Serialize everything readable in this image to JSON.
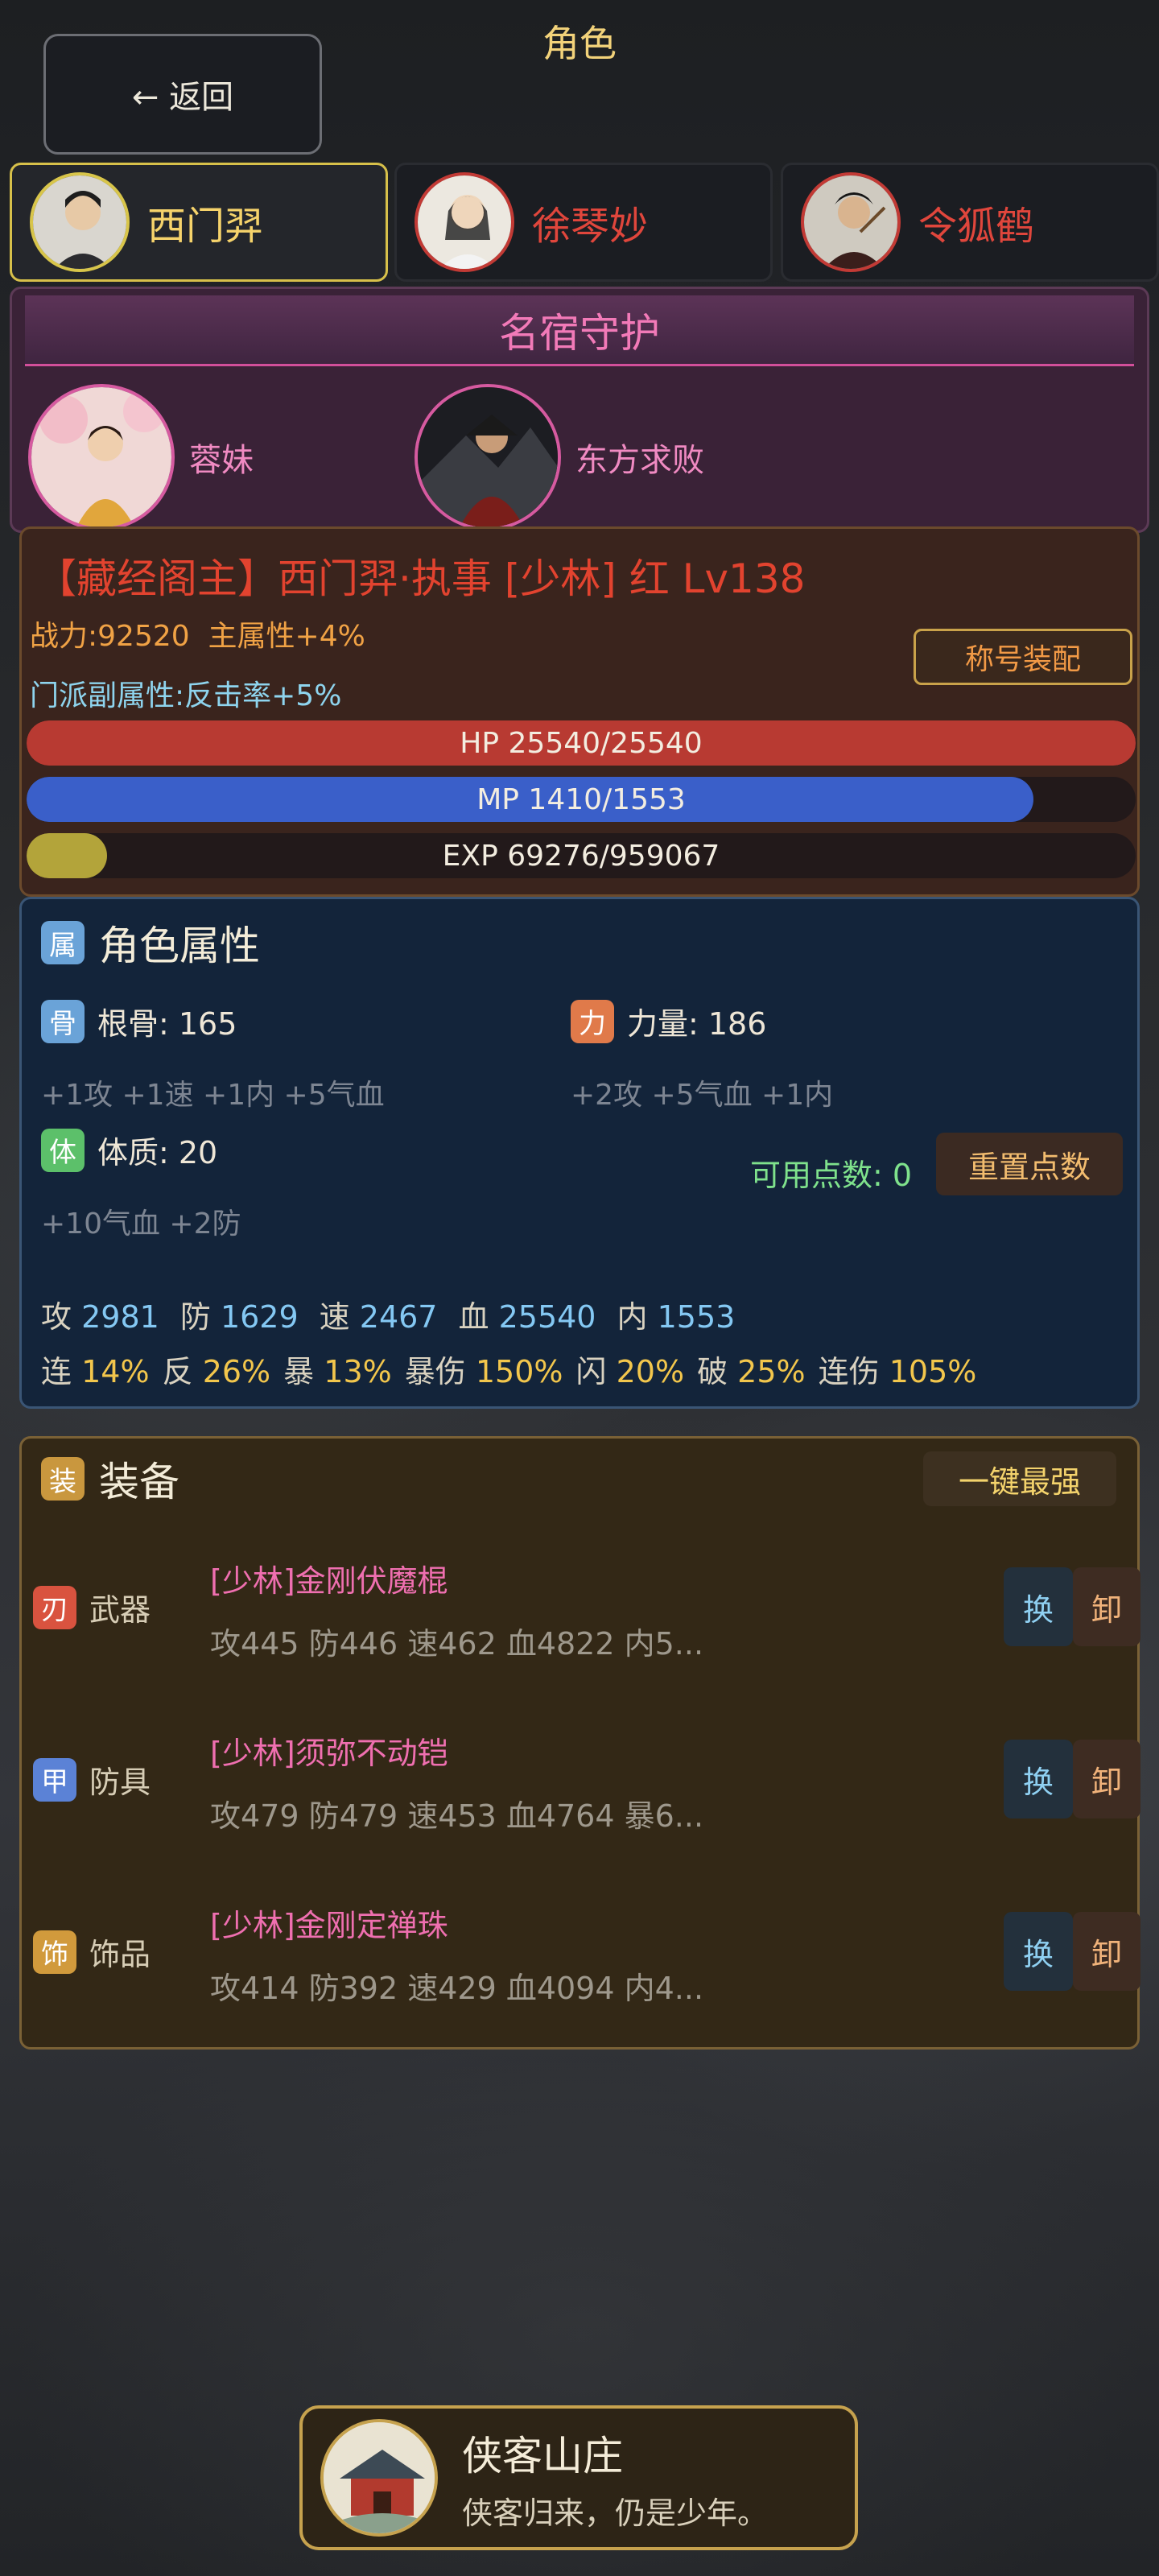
{
  "header": {
    "title": "角色",
    "back_label": "← 返回"
  },
  "heroes": [
    {
      "name": "西门羿",
      "active": true
    },
    {
      "name": "徐琴妙",
      "active": false
    },
    {
      "name": "令狐鹤",
      "active": false
    }
  ],
  "guardian": {
    "title": "名宿守护",
    "slots": [
      {
        "name": "蓉妹"
      },
      {
        "name": "东方求败"
      }
    ]
  },
  "status": {
    "title_line": "【藏经阁主】西门羿·执事 [少林] 红 Lv138",
    "power_line": "战力:92520  主属性+4%",
    "sect_attr_line": "门派副属性:反击率+5%",
    "title_button": "称号装配",
    "hp": {
      "label": "HP 25540/25540",
      "current": 25540,
      "max": 25540,
      "color": "#b83a32"
    },
    "mp": {
      "label": "MP 1410/1553",
      "current": 1410,
      "max": 1553,
      "color": "#3a5fc9"
    },
    "exp": {
      "label": "EXP 69276/959067",
      "current": 69276,
      "max": 959067,
      "color": "#b3a43a"
    }
  },
  "attributes": {
    "section_icon": "属",
    "section_title": "角色属性",
    "icon_colors": {
      "bone": "#6aa3d8",
      "strength": "#e07a4a",
      "constitution": "#5cc06a",
      "section": "#6aa3d8"
    },
    "bone": {
      "icon": "骨",
      "label": "根骨: 165",
      "bonus": "+1攻 +1速 +1内 +5气血"
    },
    "strength": {
      "icon": "力",
      "label": "力量: 186",
      "bonus": "+2攻 +5气血 +1内"
    },
    "constitution": {
      "icon": "体",
      "label": "体质: 20",
      "bonus": "+10气血 +2防"
    },
    "available_points": "可用点数: 0",
    "reset_button": "重置点数",
    "stats": [
      {
        "k": "攻",
        "v": "2981"
      },
      {
        "k": "防",
        "v": "1629"
      },
      {
        "k": "速",
        "v": "2467"
      },
      {
        "k": "血",
        "v": "25540"
      },
      {
        "k": "内",
        "v": "1553"
      }
    ],
    "rates": [
      {
        "k": "连",
        "v": "14%"
      },
      {
        "k": "反",
        "v": "26%"
      },
      {
        "k": "暴",
        "v": "13%"
      },
      {
        "k": "暴伤",
        "v": "150%"
      },
      {
        "k": "闪",
        "v": "20%"
      },
      {
        "k": "破",
        "v": "25%"
      },
      {
        "k": "连伤",
        "v": "105%"
      }
    ]
  },
  "equipment": {
    "section_icon": "装",
    "section_title": "装备",
    "oneclick_button": "一键最强",
    "swap_label": "换",
    "unequip_label": "卸",
    "items": [
      {
        "slot_icon": "刃",
        "slot": "武器",
        "icon_color": "#d9533f",
        "name": "[少林]金刚伏魔棍",
        "stats": "攻445 防446 速462 血4822 内5..."
      },
      {
        "slot_icon": "甲",
        "slot": "防具",
        "icon_color": "#5b82d6",
        "name": "[少林]须弥不动铠",
        "stats": "攻479 防479 速453 血4764 暴6..."
      },
      {
        "slot_icon": "饰",
        "slot": "饰品",
        "icon_color": "#d19a3c",
        "name": "[少林]金刚定禅珠",
        "stats": "攻414 防392 速429 血4094 内4..."
      }
    ]
  },
  "footer": {
    "title": "侠客山庄",
    "subtitle": "侠客归来，仍是少年。"
  }
}
